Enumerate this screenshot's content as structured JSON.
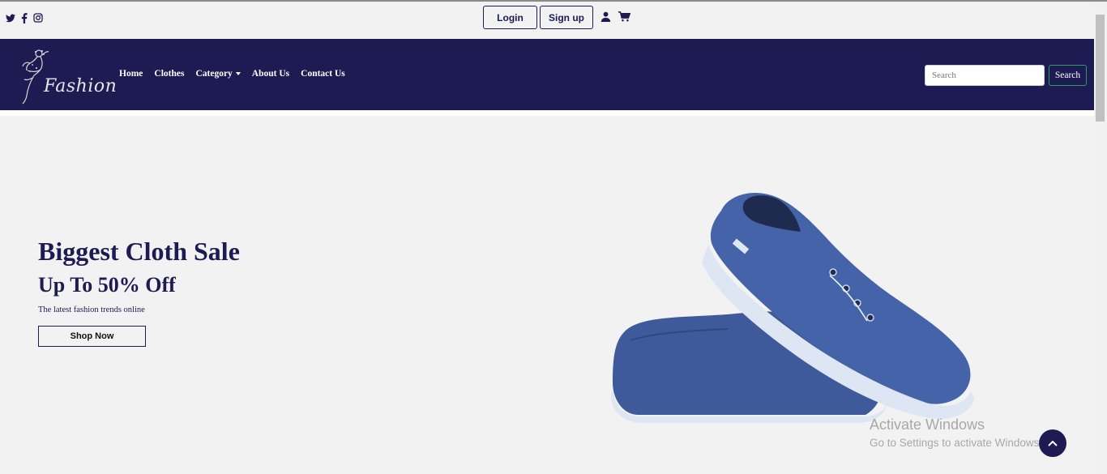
{
  "topbar": {
    "social_icons": [
      "twitter-icon",
      "facebook-icon",
      "instagram-icon"
    ],
    "login_label": "Login",
    "signup_label": "Sign up",
    "user_icon": "user-icon",
    "cart_icon": "cart-icon"
  },
  "nav": {
    "logo_text": "Fashion",
    "items": [
      {
        "label": "Home"
      },
      {
        "label": "Clothes"
      },
      {
        "label": "Category",
        "dropdown": true
      },
      {
        "label": "About Us"
      },
      {
        "label": "Contact Us"
      }
    ],
    "search_placeholder": "Search",
    "search_button": "Search"
  },
  "hero": {
    "title": "Biggest Cloth Sale",
    "subtitle": "Up To 50% Off",
    "tagline": "The latest fashion trends online",
    "cta": "Shop Now"
  },
  "watermark": {
    "title": "Activate Windows",
    "subtitle": "Go to Settings to activate Windows."
  },
  "colors": {
    "brand": "#1d1b52",
    "background": "#f2f2f2",
    "shoe": "#3e5a9a",
    "search_button_border": "#2a9d68"
  }
}
